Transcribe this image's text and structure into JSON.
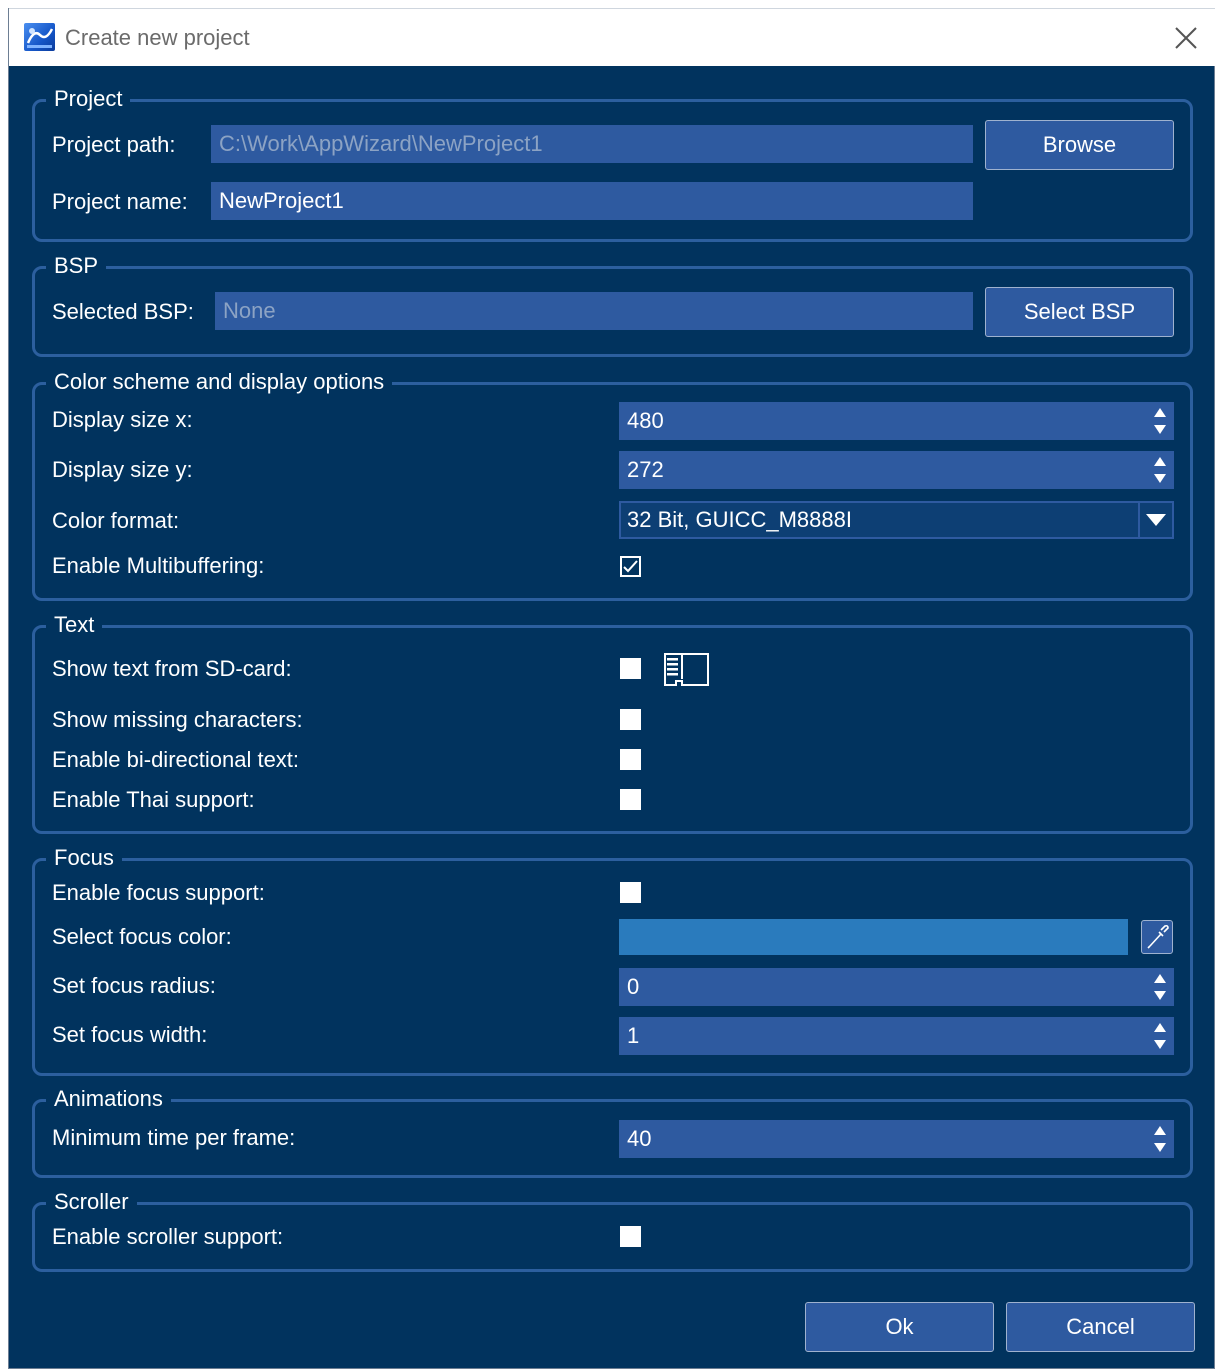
{
  "window": {
    "title": "Create new project"
  },
  "project": {
    "group_title": "Project",
    "path_label": "Project path:",
    "path_value": "C:\\Work\\AppWizard\\NewProject1",
    "browse_label": "Browse",
    "name_label": "Project name:",
    "name_value": "NewProject1"
  },
  "bsp": {
    "group_title": "BSP",
    "selected_label": "Selected BSP:",
    "selected_value": "None",
    "select_button": "Select BSP"
  },
  "color": {
    "group_title": "Color scheme and display options",
    "size_x_label": "Display size x:",
    "size_x_value": "480",
    "size_y_label": "Display size y:",
    "size_y_value": "272",
    "format_label": "Color format:",
    "format_value": "32 Bit, GUICC_M8888I",
    "multibuffer_label": "Enable Multibuffering:",
    "multibuffer_checked": true
  },
  "text": {
    "group_title": "Text",
    "sd_label": "Show text from SD-card:",
    "sd_checked": false,
    "missing_label": "Show missing characters:",
    "missing_checked": false,
    "bidi_label": "Enable bi-directional text:",
    "bidi_checked": false,
    "thai_label": "Enable Thai support:",
    "thai_checked": false
  },
  "focus": {
    "group_title": "Focus",
    "enable_label": "Enable focus support:",
    "enable_checked": false,
    "color_label": "Select focus color:",
    "color_value": "#2a7bbd",
    "radius_label": "Set focus radius:",
    "radius_value": "0",
    "width_label": "Set focus width:",
    "width_value": "1"
  },
  "animations": {
    "group_title": "Animations",
    "min_time_label": "Minimum time per frame:",
    "min_time_value": "40"
  },
  "scroller": {
    "group_title": "Scroller",
    "enable_label": "Enable scroller support:",
    "enable_checked": false
  },
  "footer": {
    "ok_label": "Ok",
    "cancel_label": "Cancel"
  },
  "colors": {
    "background": "#01335e",
    "field": "#2e5aa0",
    "group_border": "#2c5f9e",
    "focus_color": "#2a7bbd"
  }
}
